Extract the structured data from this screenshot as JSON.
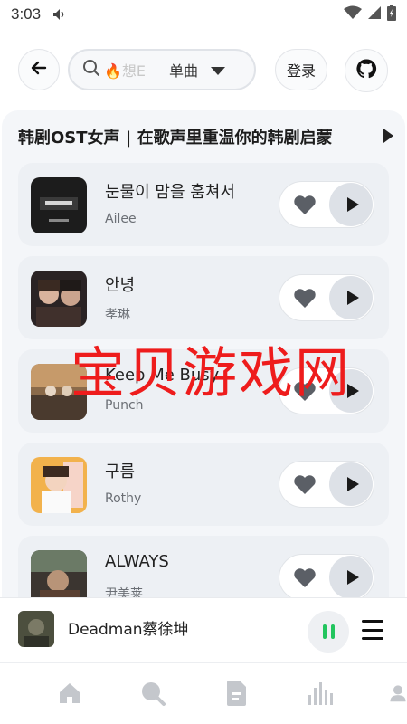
{
  "status_bar": {
    "time": "3:03"
  },
  "top_bar": {
    "search_placeholder": "🔥想E",
    "search_scope": "单曲",
    "login_label": "登录"
  },
  "playlist": {
    "title": "韩剧OST女声 | 在歌声里重温你的韩剧启蒙",
    "songs": [
      {
        "title": "눈물이 맘을 훔쳐서",
        "artist": "Ailee"
      },
      {
        "title": "안녕",
        "artist": "孝琳"
      },
      {
        "title": "Keep Me Busy",
        "artist": "Punch"
      },
      {
        "title": "구름",
        "artist": "Rothy"
      },
      {
        "title": "ALWAYS",
        "artist": "尹美莱"
      }
    ]
  },
  "watermark": "宝贝游戏网",
  "mini_player": {
    "now_playing": "Deadman蔡徐坤"
  },
  "nav": {
    "items": [
      "home-icon",
      "search-icon",
      "document-icon",
      "chart-icon",
      "user-icon"
    ]
  },
  "colors": {
    "accent_green": "#22c55e",
    "watermark_red": "#ee1c1c"
  }
}
